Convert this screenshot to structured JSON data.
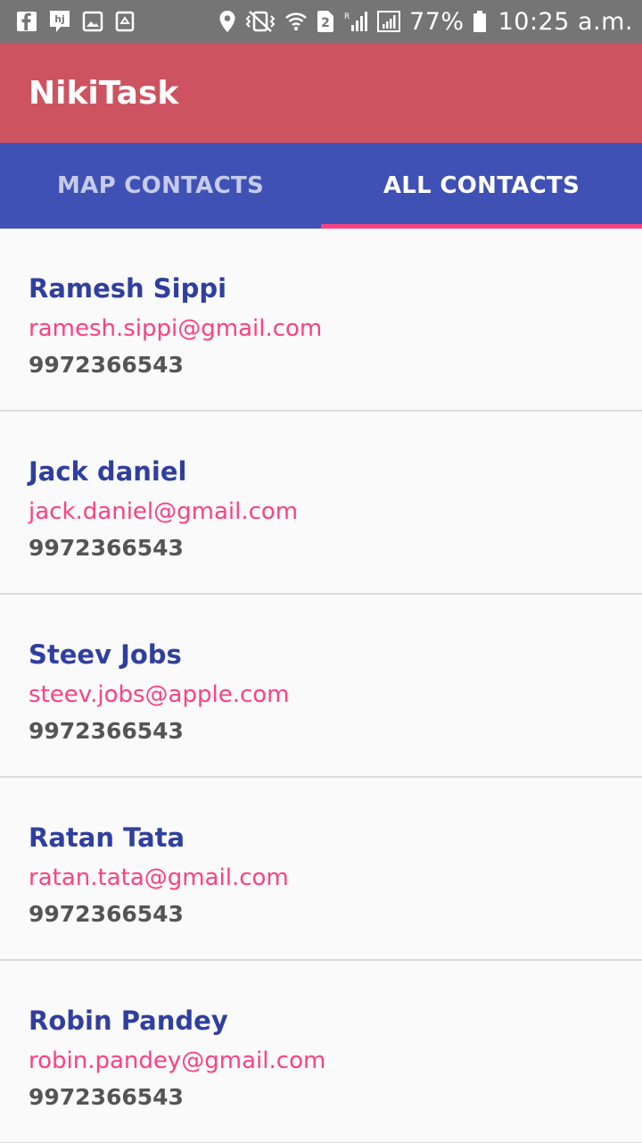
{
  "status_bar": {
    "left_icons": [
      "facebook-icon",
      "hj-icon",
      "image-icon",
      "recycle-icon"
    ],
    "right_icons": [
      "location-icon",
      "vibrate-icon",
      "wifi-icon",
      "sim2-icon",
      "signal-roaming-icon",
      "signal-icon",
      "battery-icon"
    ],
    "sim_label": "2",
    "roaming_label": "R",
    "battery": "77%",
    "time": "10:25 a.m."
  },
  "app_bar": {
    "title": "NikiTask",
    "background": "#cd5360"
  },
  "tabs": {
    "items": [
      {
        "label": "MAP CONTACTS",
        "active": false
      },
      {
        "label": "ALL CONTACTS",
        "active": true
      }
    ],
    "background": "#3f51b5",
    "indicator_color": "#ff4081"
  },
  "contacts": [
    {
      "name": "Ramesh Sippi",
      "email": "ramesh.sippi@gmail.com",
      "phone": "9972366543"
    },
    {
      "name": "Jack daniel",
      "email": "jack.daniel@gmail.com",
      "phone": "9972366543"
    },
    {
      "name": "Steev Jobs",
      "email": "steev.jobs@apple.com",
      "phone": "9972366543"
    },
    {
      "name": "Ratan Tata",
      "email": "ratan.tata@gmail.com",
      "phone": "9972366543"
    },
    {
      "name": "Robin Pandey",
      "email": "robin.pandey@gmail.com",
      "phone": "9972366543"
    }
  ],
  "colors": {
    "name": "#303f9f",
    "email": "#ff4081",
    "phone": "#555555",
    "status_bar": "#757575"
  }
}
